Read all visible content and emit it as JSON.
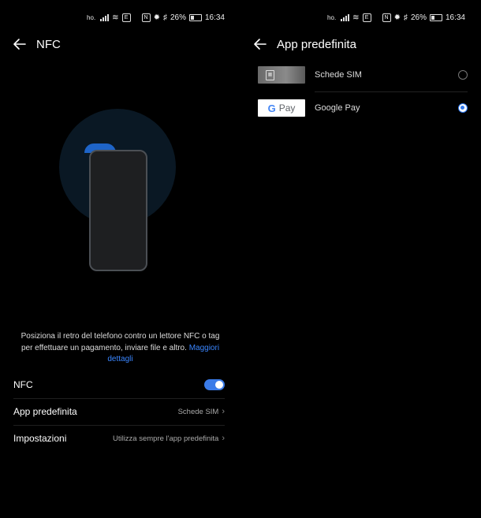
{
  "status_bar": {
    "carrier": "ho.",
    "battery_text": "26%",
    "time": "16:34",
    "battery_level": 0.26
  },
  "left": {
    "title": "NFC",
    "description": "Posiziona il retro del telefono contro un lettore NFC o tag per effettuare un pagamento, inviare file e altro.",
    "description_link": "Maggiori dettagli",
    "nfc_label": "NFC",
    "nfc_enabled": true,
    "default_app_label": "App predefinita",
    "default_app_value": "Schede SIM",
    "settings_label": "Impostazioni",
    "settings_value": "Utilizza sempre l'app predefinita"
  },
  "right": {
    "title": "App predefinita",
    "apps": [
      {
        "label": "Schede SIM",
        "icon": "sim-card-icon",
        "selected": false
      },
      {
        "label": "Google Pay",
        "logo_text": "Pay",
        "logo_letter": "G",
        "icon": "google-pay-logo",
        "selected": true
      }
    ]
  },
  "colors": {
    "accent": "#3a7be8",
    "link": "#3a86ff",
    "background": "#000000"
  }
}
